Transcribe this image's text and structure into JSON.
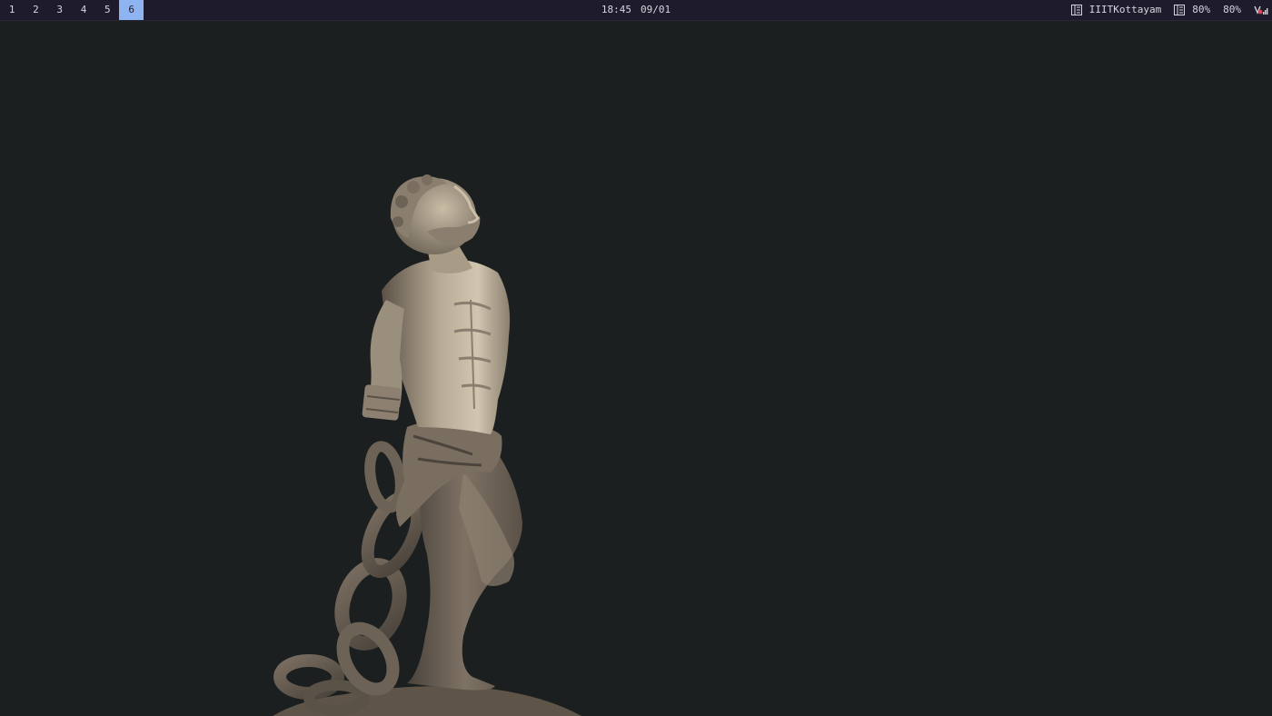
{
  "workspaces": {
    "items": [
      {
        "label": "1"
      },
      {
        "label": "2"
      },
      {
        "label": "3"
      },
      {
        "label": "4"
      },
      {
        "label": "5"
      },
      {
        "label": "6"
      }
    ],
    "active_label": "6"
  },
  "clock": {
    "time": "18:45",
    "date": "09/01"
  },
  "tray": {
    "network": {
      "icon": "network-icon",
      "label": "IIITKottayam"
    },
    "volume": {
      "icon": "volume-icon",
      "label": "80%"
    },
    "brightness": {
      "label": "80%"
    },
    "indicator": {
      "icon": "signal-icon"
    }
  },
  "wallpaper": {
    "subject": "statue-icon"
  },
  "colors": {
    "bar_bg": "#1d1b2c",
    "active_ws": "#8eb4f2",
    "desktop_bg": "#1b1f20",
    "stone_light": "#cbbfa8",
    "stone_mid": "#8d8070",
    "stone_dark": "#4c453d"
  }
}
